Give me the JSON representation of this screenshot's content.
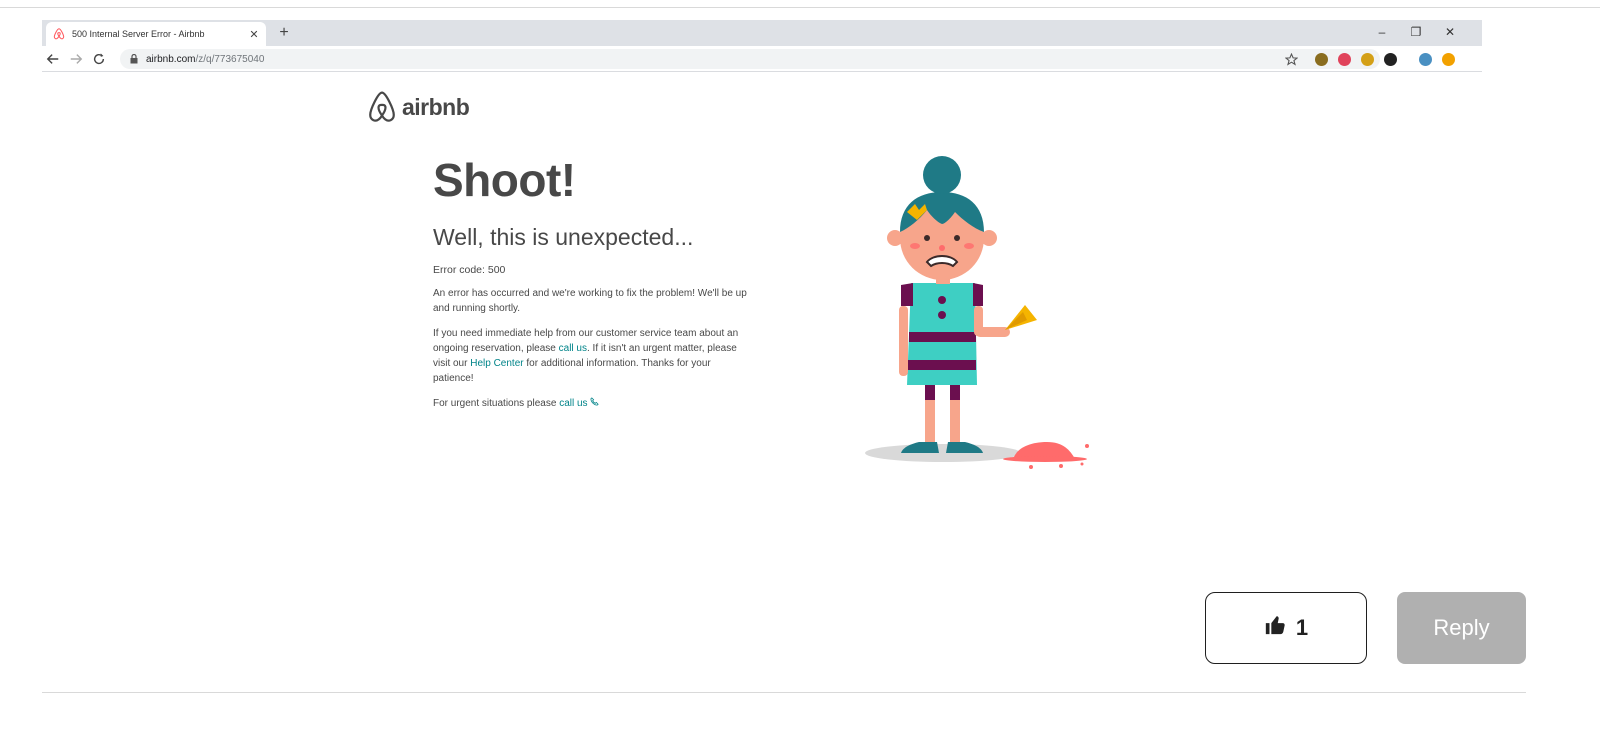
{
  "browser": {
    "tab_title": "500 Internal Server Error - Airbnb",
    "tab_close": "✕",
    "new_tab": "+",
    "minimize": "–",
    "restore": "❐",
    "close": "✕",
    "url_host": "airbnb.com",
    "url_path": "/z/q/773675040",
    "extension_colors": [
      "#8a6d1f",
      "#e0435b",
      "#d4a017",
      "#222222",
      "#4a90c2",
      "#f2a100"
    ]
  },
  "page": {
    "logo_text": "airbnb",
    "brand_color": "#ff5a5f",
    "heading": "Shoot!",
    "subheading": "Well, this is unexpected...",
    "error_code": "Error code: 500",
    "para1": "An error has occurred and we're working to fix the problem! We'll be up and running shortly.",
    "para2_before": "If you need immediate help from our customer service team about an ongoing reservation, please ",
    "para2_link1": "call us",
    "para2_middle": ". If it isn't an urgent matter, please visit our ",
    "para2_link2": "Help Center",
    "para2_after": " for additional information. Thanks for your patience!",
    "para3_before": "For urgent situations please ",
    "para3_link": "call us",
    "link_color": "#008489"
  },
  "forum": {
    "like_count": "1",
    "reply_label": "Reply"
  }
}
